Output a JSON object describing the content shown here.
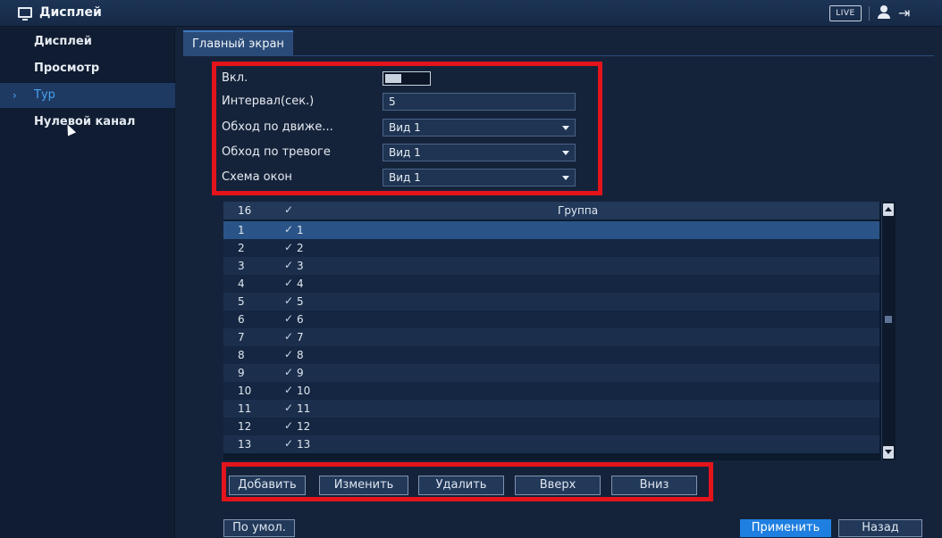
{
  "header": {
    "title": "Дисплей",
    "live_label": "LIVE",
    "icons": [
      "display-icon",
      "user-icon",
      "logout-icon"
    ]
  },
  "sidebar": {
    "items": [
      {
        "label": "Дисплей"
      },
      {
        "label": "Просмотр"
      },
      {
        "label": "Тур",
        "active": true
      },
      {
        "label": "Нулевой канал"
      }
    ]
  },
  "tabs": [
    {
      "label": "Главный экран"
    }
  ],
  "form": {
    "enable_label": "Вкл.",
    "enable_value": true,
    "interval_label": "Интервал(сек.)",
    "interval_value": "5",
    "motion_label": "Обход по движе...",
    "motion_value": "Вид 1",
    "alarm_label": "Обход по тревоге",
    "alarm_value": "Вид 1",
    "layout_label": "Схема окон",
    "layout_value": "Вид 1"
  },
  "table": {
    "header": {
      "num": "16",
      "check": "✓",
      "group": "Группа"
    },
    "rows": [
      {
        "num": "1",
        "group": "1"
      },
      {
        "num": "2",
        "group": "2"
      },
      {
        "num": "3",
        "group": "3"
      },
      {
        "num": "4",
        "group": "4"
      },
      {
        "num": "5",
        "group": "5"
      },
      {
        "num": "6",
        "group": "6"
      },
      {
        "num": "7",
        "group": "7"
      },
      {
        "num": "8",
        "group": "8"
      },
      {
        "num": "9",
        "group": "9"
      },
      {
        "num": "10",
        "group": "10"
      },
      {
        "num": "11",
        "group": "11"
      },
      {
        "num": "12",
        "group": "12"
      },
      {
        "num": "13",
        "group": "13"
      }
    ],
    "check_mark": "✓"
  },
  "actions": {
    "add": "Добавить",
    "edit": "Изменить",
    "delete": "Удалить",
    "up": "Вверх",
    "down": "Вниз"
  },
  "footer": {
    "default": "По умол.",
    "apply": "Применить",
    "back": "Назад"
  },
  "colors": {
    "accent": "#1f7fe0",
    "highlight": "#e3141c",
    "background": "#15233a"
  }
}
